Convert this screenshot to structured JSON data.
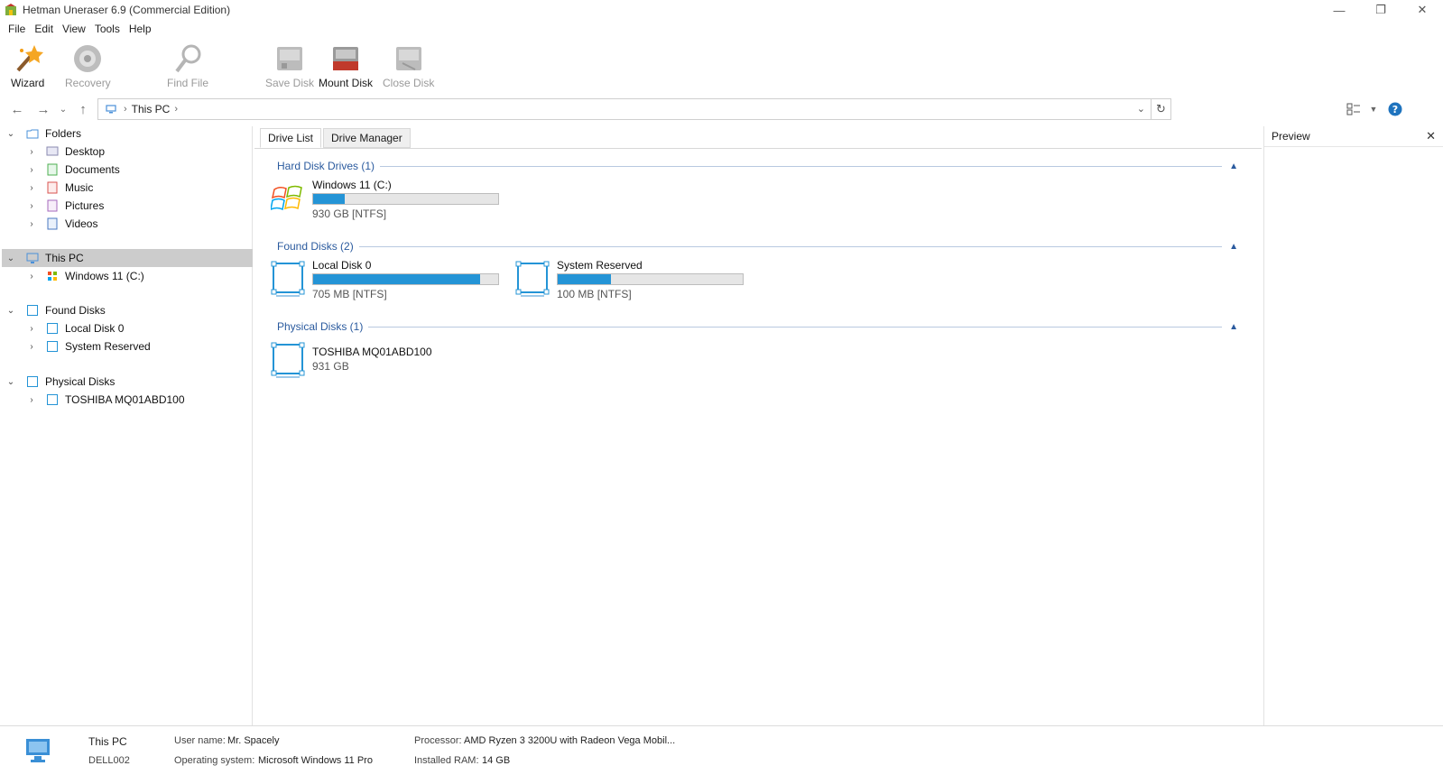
{
  "window": {
    "title": "Hetman Uneraser 6.9 (Commercial Edition)",
    "controls": [
      "—",
      "❐",
      "✕"
    ]
  },
  "menu": [
    "File",
    "Edit",
    "View",
    "Tools",
    "Help"
  ],
  "toolbar": {
    "wizard": "Wizard",
    "recovery": "Recovery",
    "find_file": "Find File",
    "save_disk": "Save Disk",
    "mount_disk": "Mount Disk",
    "close_disk": "Close Disk"
  },
  "nav": {
    "breadcrumb": [
      "This PC"
    ],
    "back_icon": "arrow-left-icon",
    "forward_icon": "arrow-right-icon",
    "up_icon": "arrow-up-icon"
  },
  "tree": {
    "folders": "Folders",
    "folder_items": [
      "Desktop",
      "Documents",
      "Music",
      "Pictures",
      "Videos"
    ],
    "this_pc": "This PC",
    "this_pc_items": [
      "Windows 11 (C:)"
    ],
    "found_disks": "Found Disks",
    "found_items": [
      "Local Disk 0",
      "System Reserved"
    ],
    "physical_disks": "Physical Disks",
    "physical_items": [
      "TOSHIBA MQ01ABD100"
    ]
  },
  "tabs": [
    "Drive List",
    "Drive Manager"
  ],
  "groups": {
    "hdd": {
      "title": "Hard Disk Drives (1)",
      "drives": [
        {
          "name": "Windows 11 (C:)",
          "size": "930 GB [NTFS]",
          "fill": 0.17
        }
      ]
    },
    "found": {
      "title": "Found Disks (2)",
      "drives": [
        {
          "name": "Local Disk 0",
          "size": "705 MB [NTFS]",
          "fill": 0.9
        },
        {
          "name": "System Reserved",
          "size": "100 MB [NTFS]",
          "fill": 0.29
        }
      ]
    },
    "physical": {
      "title": "Physical Disks (1)",
      "drives": [
        {
          "name": "TOSHIBA MQ01ABD100",
          "size": "931 GB"
        }
      ]
    }
  },
  "preview": {
    "title": "Preview"
  },
  "status": {
    "name": "This PC",
    "host": "DELL002",
    "user_label": "User name:",
    "user_value": "Mr. Spacely",
    "os_label": "Operating system:",
    "os_value": "Microsoft Windows 11 Pro",
    "cpu_label": "Processor:",
    "cpu_value": "AMD Ryzen 3 3200U with Radeon Vega Mobil...",
    "ram_label": "Installed RAM:",
    "ram_value": "14 GB"
  },
  "colors": {
    "accent": "#2494d6",
    "group_title": "#2a5a9e",
    "selected": "#cccccc"
  }
}
